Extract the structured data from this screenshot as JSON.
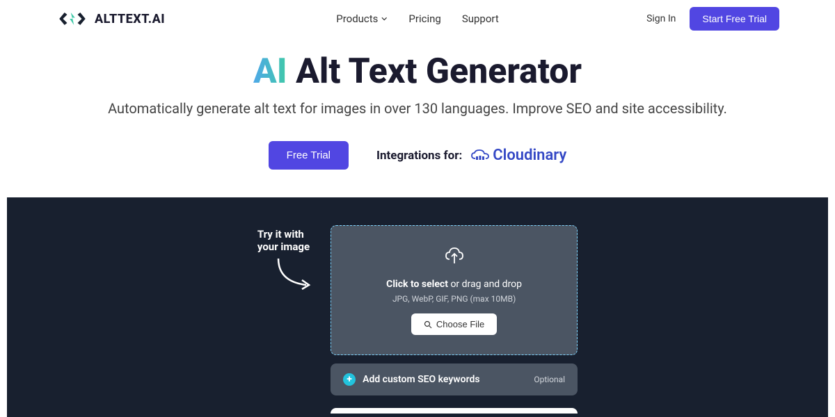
{
  "header": {
    "logo_text": "ALTTEXT.AI",
    "nav": {
      "products": "Products",
      "pricing": "Pricing",
      "support": "Support"
    },
    "sign_in": "Sign In",
    "start_trial": "Start Free Trial"
  },
  "hero": {
    "title_ai": "AI",
    "title_rest": " Alt Text Generator",
    "subtitle": "Automatically generate alt text for images in over 130 languages. Improve SEO and site accessibility.",
    "free_trial": "Free Trial",
    "integrations_label": "Integrations for:",
    "integration_name": "Cloudinary"
  },
  "try": {
    "label_line1": "Try it with",
    "label_line2": "your image",
    "upload": {
      "click_bold": "Click to select",
      "click_rest": " or drag and drop",
      "formats": "JPG, WebP, GIF, PNG (max 10MB)",
      "choose_file": "Choose File"
    },
    "seo": {
      "text": "Add custom SEO keywords",
      "optional": "Optional"
    }
  }
}
